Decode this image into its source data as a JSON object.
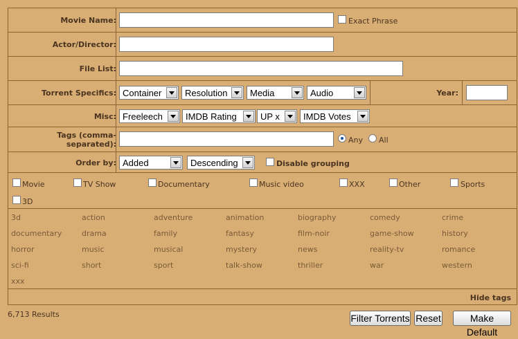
{
  "form": {
    "movie_name_label": "Movie Name:",
    "movie_name_value": "",
    "exact_phrase_label": "Exact Phrase",
    "actor_director_label": "Actor/Director:",
    "actor_director_value": "",
    "file_list_label": "File List:",
    "file_list_value": "",
    "torrent_specifics_label": "Torrent Specifics:",
    "container_value": "Container",
    "resolution_value": "Resolution",
    "media_value": "Media",
    "audio_value": "Audio",
    "year_label": "Year:",
    "year_value": "",
    "misc_label": "Misc:",
    "freeleech_value": "Freeleech",
    "imdb_rating_value": "IMDB Rating",
    "up_value": "UP x",
    "imdb_votes_value": "IMDB Votes",
    "tags_label_line1": "Tags (comma-",
    "tags_label_line2": "separated):",
    "tags_value": "",
    "any_label": "Any",
    "all_label": "All",
    "order_by_label": "Order by:",
    "order_field_value": "Added",
    "order_dir_value": "Descending",
    "disable_grouping_label": "Disable grouping"
  },
  "categories": [
    "Movie",
    "TV Show",
    "Documentary",
    "Music video",
    "XXX",
    "Other",
    "Sports",
    "3D"
  ],
  "tags": [
    "3d",
    "action",
    "adventure",
    "animation",
    "biography",
    "comedy",
    "crime",
    "documentary",
    "drama",
    "family",
    "fantasy",
    "film-noir",
    "game-show",
    "history",
    "horror",
    "music",
    "musical",
    "mystery",
    "news",
    "reality-tv",
    "romance",
    "sci-fi",
    "short",
    "sport",
    "talk-show",
    "thriller",
    "war",
    "western",
    "xxx"
  ],
  "hide_tags_label": "Hide tags",
  "results_text": "6,713 Results",
  "buttons": {
    "filter": "Filter Torrents",
    "reset": "Reset",
    "make_default": "Make Default"
  },
  "colors": {
    "background": "#d9ae75",
    "border": "#8b6434",
    "text": "#4a3420",
    "tag_text": "#7a5a38"
  }
}
